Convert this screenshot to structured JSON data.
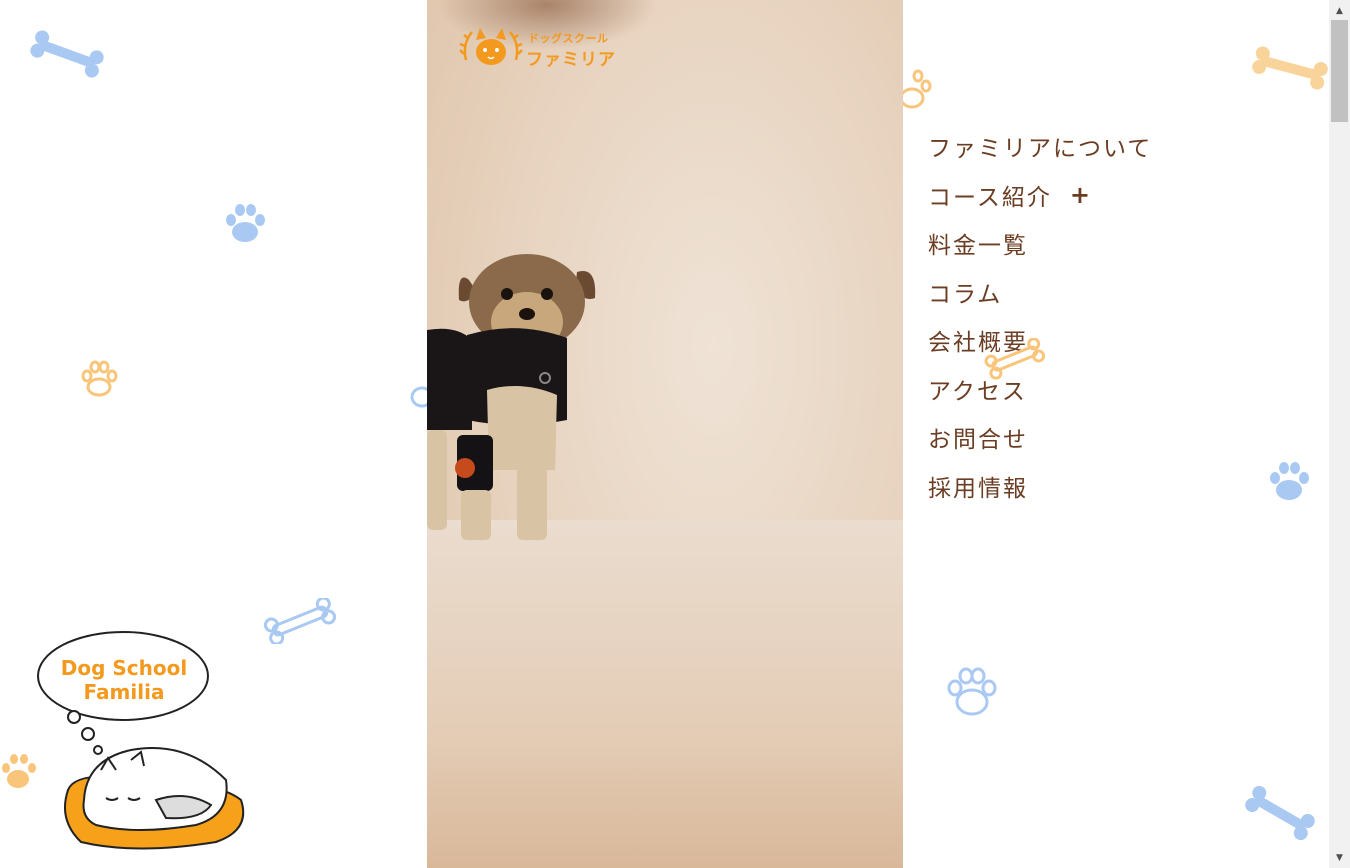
{
  "logo": {
    "small_text": "ドッグスクール",
    "big_text": "ファミリア"
  },
  "nav": {
    "items": [
      {
        "label": "ファミリアについて",
        "has_submenu": false
      },
      {
        "label": "コース紹介",
        "has_submenu": true,
        "toggle": "+"
      },
      {
        "label": "料金一覧",
        "has_submenu": false
      },
      {
        "label": "コラム",
        "has_submenu": false
      },
      {
        "label": "会社概要",
        "has_submenu": false
      },
      {
        "label": "アクセス",
        "has_submenu": false
      },
      {
        "label": "お問合せ",
        "has_submenu": false
      },
      {
        "label": "採用情報",
        "has_submenu": false
      }
    ]
  },
  "mascot": {
    "line1": "Dog School",
    "line2": "Familia"
  },
  "colors": {
    "accent_orange": "#f39a1e",
    "nav_text": "#6b3d22",
    "bone_blue": "#a9c9f3",
    "bone_orange": "#f9d49a"
  },
  "scrollbar": {
    "up_arrow": "▲",
    "down_arrow": "▼"
  }
}
